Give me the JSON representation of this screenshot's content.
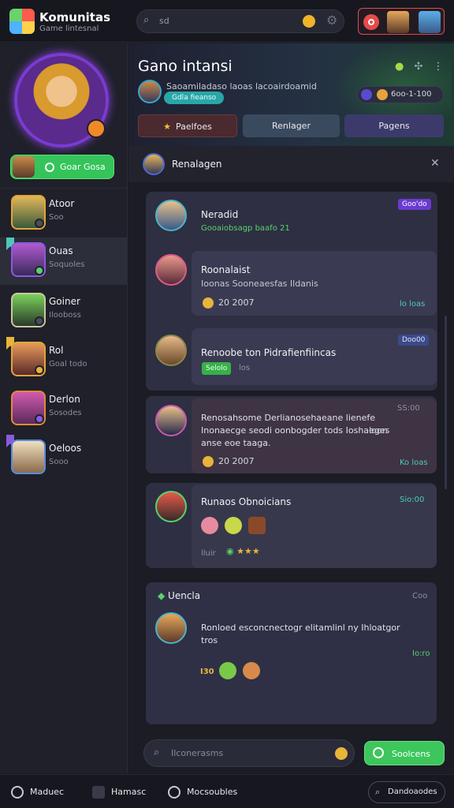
{
  "app": {
    "name": "Komunitas",
    "subtitle": "Game lintesnal"
  },
  "search": {
    "text": "sd"
  },
  "profile": {
    "online_label": "Goar Gosa"
  },
  "contacts": [
    {
      "name": "Atoor",
      "sub": "Soo"
    },
    {
      "name": "Ouas",
      "sub": "Soquoles"
    },
    {
      "name": "Goiner",
      "sub": "Ilooboss"
    },
    {
      "name": "Rol",
      "sub": "Goal todo"
    },
    {
      "name": "Derlon",
      "sub": "Sosodes"
    },
    {
      "name": "Oeloos",
      "sub": "Sooo"
    }
  ],
  "header": {
    "title": "Gano intansi",
    "line": "Saoamiladaso laoas lacoairdoamid",
    "tag": "Gdla fieanso",
    "stat": "6oo-1-100"
  },
  "tabs": [
    {
      "label": "Paelfoes"
    },
    {
      "label": "Renlager"
    },
    {
      "label": "Pagens"
    }
  ],
  "feed": {
    "title": "Renalagen",
    "messages": [
      {
        "name": "Neradid",
        "text": "Gooaiobsagp baafo 21",
        "badge": "Goo'do"
      },
      {
        "name": "Roonalaist",
        "text": "Ioonas Sooneaesfas Ildanis",
        "time": "20 2007",
        "meta": "lo loas"
      },
      {
        "name": "Renoobe ton Pidrafienfiincas",
        "label": "Selolo",
        "time": "los",
        "badge": "Doo00"
      },
      {
        "name": "Renosahsome Derlianosehaeane lienefe Inonaecge seodi oonbogder tods Ioshaeges anse eoe taaga.",
        "extra": "Ioon",
        "time": "20 2007",
        "meta": "Ko loas",
        "badge": "SS:00"
      },
      {
        "name": "Runaos Obnoicians",
        "label": "lluir",
        "badge": "Sio:00"
      },
      {
        "name": "Uencla",
        "text": "Ronloed esconcnectogr elitamlinl ny Ihloatgor tros",
        "badge_a": "I30",
        "badge_b": "Coo",
        "meta": "Io:ro"
      }
    ]
  },
  "composer": {
    "placeholder": "Ilconerasms",
    "send_label": "Soolcens"
  },
  "bottom_nav": [
    {
      "label": "Maduec"
    },
    {
      "label": "Hamasc"
    },
    {
      "label": "Mocsoubles"
    }
  ],
  "bottom_search": {
    "label": "Dandoaodes"
  },
  "colors": {
    "accent_green": "#3cc65c",
    "accent_purple": "#6a3ad1",
    "accent_teal": "#4fc8b8"
  }
}
